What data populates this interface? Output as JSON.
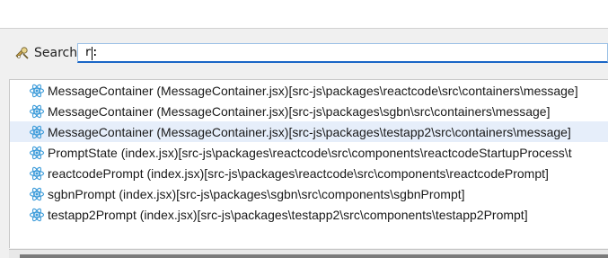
{
  "search": {
    "label": "Search",
    "value": "r:"
  },
  "results": [
    {
      "icon": "react-icon",
      "text": "MessageContainer (MessageContainer.jsx)[src-js\\packages\\reactcode\\src\\containers\\message]"
    },
    {
      "icon": "react-icon",
      "text": "MessageContainer (MessageContainer.jsx)[src-js\\packages\\sgbn\\src\\containers\\message]"
    },
    {
      "icon": "react-icon",
      "text": "MessageContainer (MessageContainer.jsx)[src-js\\packages\\testapp2\\src\\containers\\message]",
      "selected": true
    },
    {
      "icon": "react-icon",
      "text": "PromptState (index.jsx)[src-js\\packages\\reactcode\\src\\components\\reactcodeStartupProcess\\t"
    },
    {
      "icon": "react-icon",
      "text": "reactcodePrompt (index.jsx)[src-js\\packages\\reactcode\\src\\components\\reactcodePrompt]"
    },
    {
      "icon": "react-icon",
      "text": "sgbnPrompt (index.jsx)[src-js\\packages\\sgbn\\src\\components\\sgbnPrompt]"
    },
    {
      "icon": "react-icon",
      "text": "testapp2Prompt (index.jsx)[src-js\\packages\\testapp2\\src\\components\\testapp2Prompt]"
    }
  ],
  "colors": {
    "accent": "#1a66c6",
    "react_icon": "#3a9ad9",
    "selection": "#e6eefa"
  }
}
